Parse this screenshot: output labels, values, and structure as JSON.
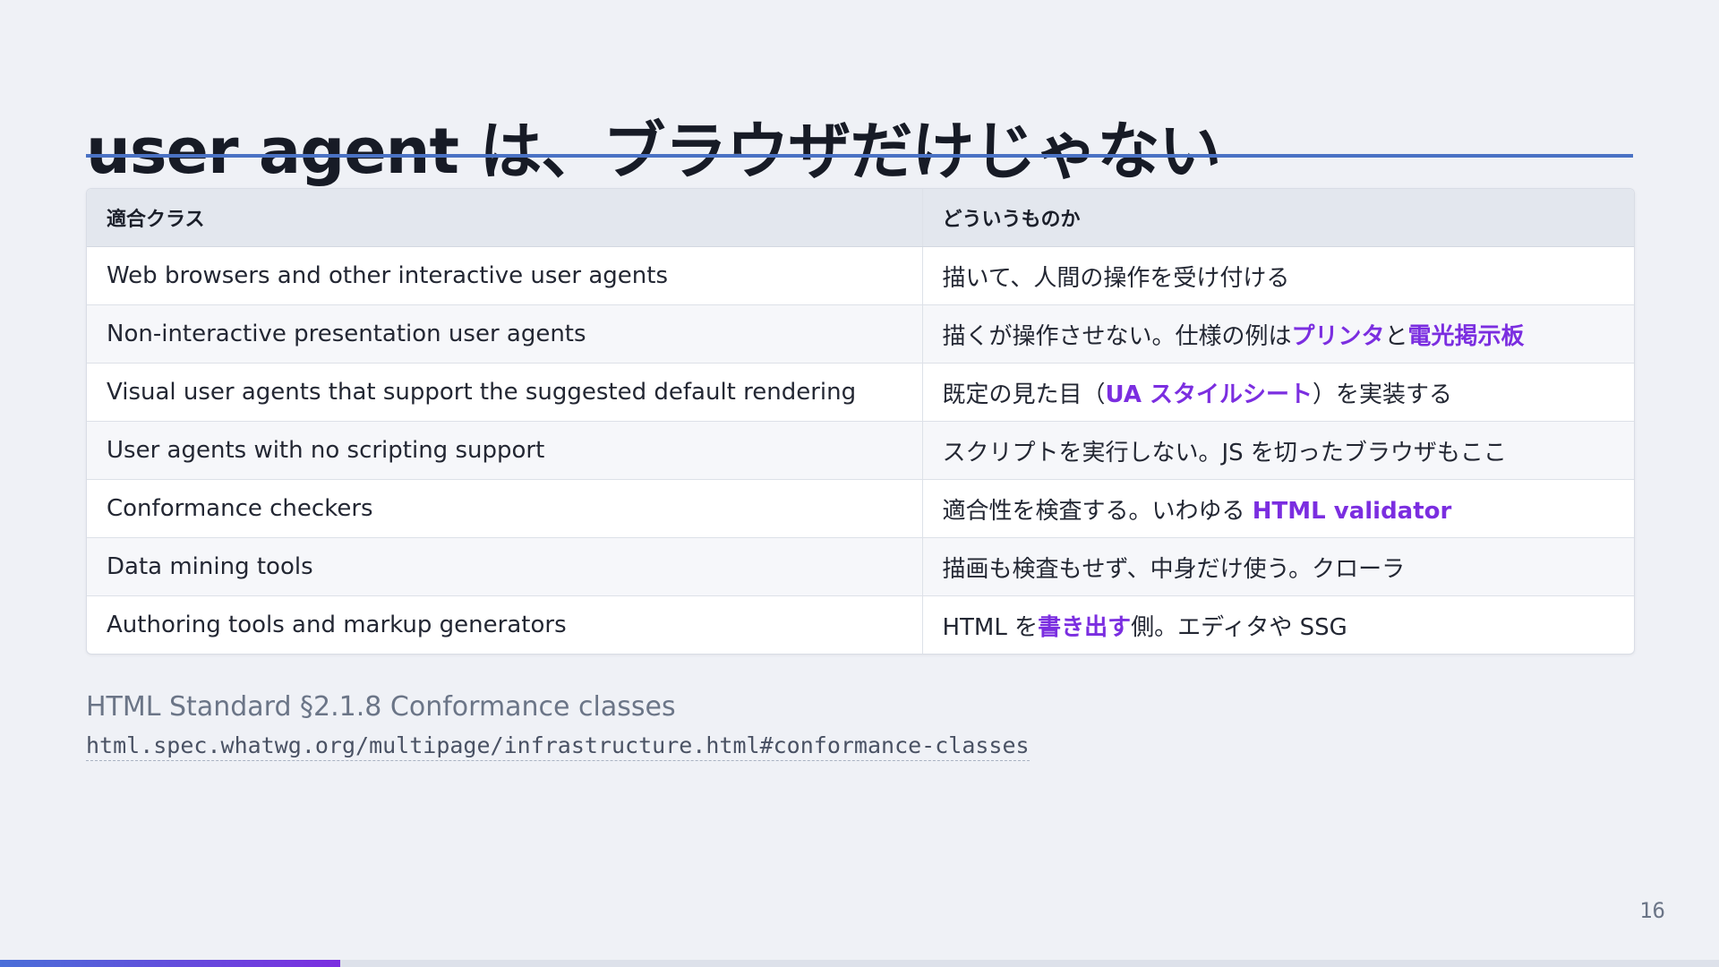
{
  "slide": {
    "title": "user agent は、ブラウザだけじゃない",
    "page_number": "16",
    "progress": 0.198
  },
  "table": {
    "headers": [
      "適合クラス",
      "どういうものか"
    ],
    "rows": [
      {
        "class": "Web browsers and other interactive user agents",
        "desc": [
          {
            "text": "描いて、人間の操作を受け付ける",
            "hl": false
          }
        ]
      },
      {
        "class": "Non-interactive presentation user agents",
        "desc": [
          {
            "text": "描くが操作させない。仕様の例は",
            "hl": false
          },
          {
            "text": "プリンタ",
            "hl": true
          },
          {
            "text": "と",
            "hl": false
          },
          {
            "text": "電光掲示板",
            "hl": true
          }
        ]
      },
      {
        "class": "Visual user agents that support the suggested default rendering",
        "desc": [
          {
            "text": "既定の見た目（",
            "hl": false
          },
          {
            "text": "UA スタイルシート",
            "hl": true
          },
          {
            "text": "）を実装する",
            "hl": false
          }
        ]
      },
      {
        "class": "User agents with no scripting support",
        "desc": [
          {
            "text": "スクリプトを実行しない。JS を切ったブラウザもここ",
            "hl": false
          }
        ]
      },
      {
        "class": "Conformance checkers",
        "desc": [
          {
            "text": "適合性を検査する。いわゆる ",
            "hl": false
          },
          {
            "text": "HTML validator",
            "hl": true
          }
        ]
      },
      {
        "class": "Data mining tools",
        "desc": [
          {
            "text": "描画も検査もせず、中身だけ使う。クローラ",
            "hl": false
          }
        ]
      },
      {
        "class": "Authoring tools and markup generators",
        "desc": [
          {
            "text": "HTML を",
            "hl": false
          },
          {
            "text": "書き出す",
            "hl": true
          },
          {
            "text": "側。エディタや SSG",
            "hl": false
          }
        ]
      }
    ]
  },
  "source": {
    "title": "HTML Standard §2.1.8 Conformance classes",
    "url": "html.spec.whatwg.org/multipage/infrastructure.html#conformance-classes"
  },
  "colors": {
    "accent": "#4a72c4",
    "highlight": "#7b2ee0",
    "background": "#eff1f6"
  }
}
